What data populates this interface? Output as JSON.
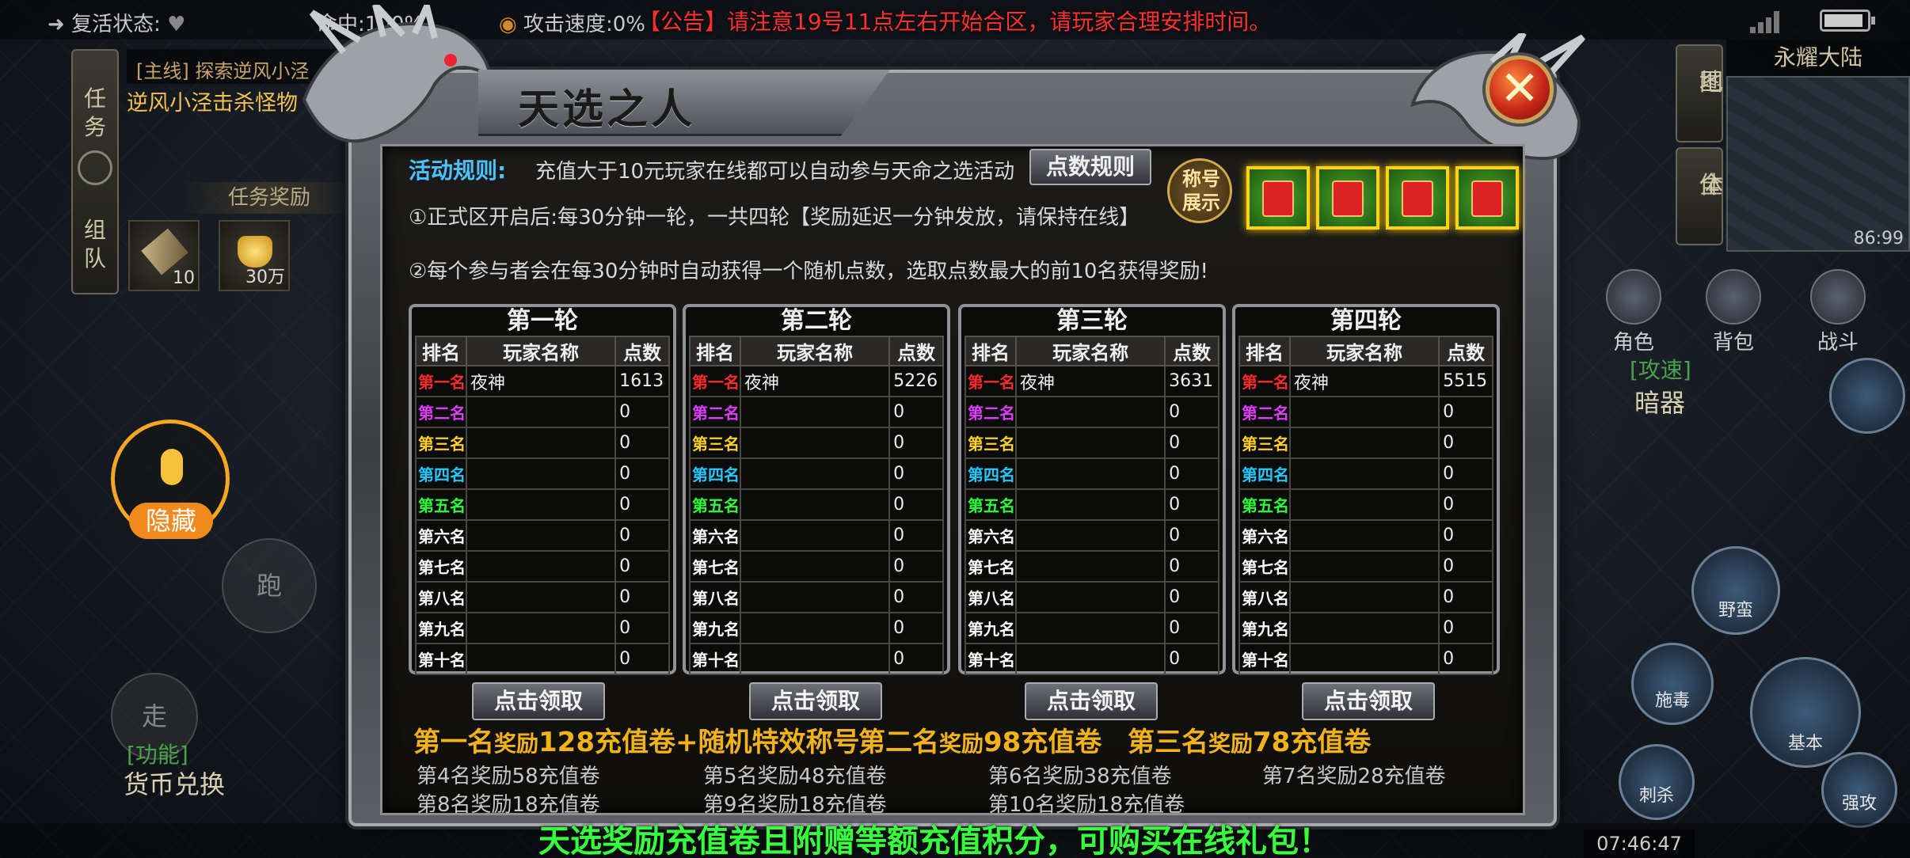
{
  "topbar": {
    "revive_label": "复活状态:",
    "hit_label": "命中:100%",
    "attack_speed_label": "攻击速度:0%",
    "announcement": "【公告】请注意19号11点左右开始合区，请玩家合理安排时间。"
  },
  "quest": {
    "tab_top": [
      "任",
      "务"
    ],
    "tab_bottom": [
      "组",
      "队"
    ],
    "header": "[主线] 探索逆风小泾",
    "line": "逆风小泾击杀怪物",
    "reward_title": "任务奖励",
    "rewards": [
      {
        "count": "10"
      },
      {
        "count": "30万"
      }
    ]
  },
  "left_controls": {
    "hide_label": "隐藏",
    "run_label": "跑",
    "walk_label": "走",
    "func_tag": "[功能]",
    "func_name": "货币兑换"
  },
  "right_panel": {
    "region": "永耀大陆",
    "coord": "86:99",
    "map_tab": [
      "地",
      "图"
    ],
    "all_tab": [
      "全",
      "体"
    ],
    "menu": [
      {
        "label": "角色"
      },
      {
        "label": "背包"
      },
      {
        "label": "战斗"
      }
    ],
    "tag": "[攻速]",
    "tag_name": "暗器",
    "skills": [
      {
        "label": "野蛮"
      },
      {
        "label": "施毒"
      },
      {
        "label": "基本"
      },
      {
        "label": "刺杀"
      },
      {
        "label": "强攻"
      }
    ],
    "time": "07:46:47"
  },
  "dialog": {
    "title": "天选之人",
    "close_glyph": "✕",
    "rule_label": "活动规则:",
    "rule_text": "充值大于10元玩家在线都可以自动参与天命之选活动",
    "rule_button": "点数规则",
    "rule1": "①正式区开启后:每30分钟一轮，一共四轮【奖励延迟一分钟发放，请保持在线】",
    "rule2": "②每个参与者会在每30分钟时自动获得一个随机点数，选取点数最大的前10名获得奖励!",
    "title_show": "称号展示",
    "col_rank": "排名",
    "col_name": "玩家名称",
    "col_points": "点数",
    "rank_labels": [
      "第一名",
      "第二名",
      "第三名",
      "第四名",
      "第五名",
      "第六名",
      "第七名",
      "第八名",
      "第九名",
      "第十名"
    ],
    "rank_colors": [
      "#ff2a2a",
      "#e03cff",
      "#ffd21a",
      "#22c8ff",
      "#2aff3a",
      "#ffffff",
      "#ffffff",
      "#ffffff",
      "#ffffff",
      "#ffffff"
    ],
    "rounds": [
      {
        "title": "第一轮",
        "rows": [
          [
            "夜神",
            "1613"
          ],
          [
            "",
            "0"
          ],
          [
            "",
            "0"
          ],
          [
            "",
            "0"
          ],
          [
            "",
            "0"
          ],
          [
            "",
            "0"
          ],
          [
            "",
            "0"
          ],
          [
            "",
            "0"
          ],
          [
            "",
            "0"
          ],
          [
            "",
            "0"
          ]
        ]
      },
      {
        "title": "第二轮",
        "rows": [
          [
            "夜神",
            "5226"
          ],
          [
            "",
            "0"
          ],
          [
            "",
            "0"
          ],
          [
            "",
            "0"
          ],
          [
            "",
            "0"
          ],
          [
            "",
            "0"
          ],
          [
            "",
            "0"
          ],
          [
            "",
            "0"
          ],
          [
            "",
            "0"
          ],
          [
            "",
            "0"
          ]
        ]
      },
      {
        "title": "第三轮",
        "rows": [
          [
            "夜神",
            "3631"
          ],
          [
            "",
            "0"
          ],
          [
            "",
            "0"
          ],
          [
            "",
            "0"
          ],
          [
            "",
            "0"
          ],
          [
            "",
            "0"
          ],
          [
            "",
            "0"
          ],
          [
            "",
            "0"
          ],
          [
            "",
            "0"
          ],
          [
            "",
            "0"
          ]
        ]
      },
      {
        "title": "第四轮",
        "rows": [
          [
            "夜神",
            "5515"
          ],
          [
            "",
            "0"
          ],
          [
            "",
            "0"
          ],
          [
            "",
            "0"
          ],
          [
            "",
            "0"
          ],
          [
            "",
            "0"
          ],
          [
            "",
            "0"
          ],
          [
            "",
            "0"
          ],
          [
            "",
            "0"
          ],
          [
            "",
            "0"
          ]
        ]
      }
    ],
    "claim_label": "点击领取",
    "prize_top": [
      {
        "rank": "第一名",
        "word": "奖励",
        "value": "128充值卷+随机特效称号"
      },
      {
        "rank": "第二名",
        "word": "奖励",
        "value": "98充值卷"
      },
      {
        "rank": "第三名",
        "word": "奖励",
        "value": "78充值卷"
      }
    ],
    "prize_small": [
      "第4名奖励58充值卷",
      "第5名奖励48充值卷",
      "第6名奖励38充值卷",
      "第7名奖励28充值卷",
      "第8名奖励18充值卷",
      "第9名奖励18充值卷",
      "第10名奖励18充值卷"
    ]
  },
  "bottom_text": "天选奖励充值卷且附赠等额充值积分，可购买在线礼包！"
}
